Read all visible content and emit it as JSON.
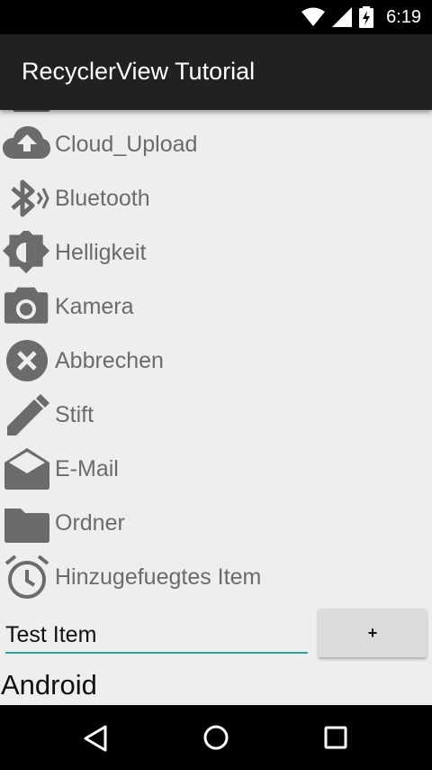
{
  "status_bar": {
    "time": "6:19",
    "icons": [
      "wifi-icon",
      "signal-icon",
      "battery-charging-icon"
    ]
  },
  "app_bar": {
    "title": "RecyclerView Tutorial"
  },
  "list": {
    "items": [
      {
        "label": "Cloud_Upload",
        "icon": "cloud-upload-icon"
      },
      {
        "label": "Bluetooth",
        "icon": "bluetooth-icon"
      },
      {
        "label": "Helligkeit",
        "icon": "brightness-icon"
      },
      {
        "label": "Kamera",
        "icon": "camera-icon"
      },
      {
        "label": "Abbrechen",
        "icon": "cancel-icon"
      },
      {
        "label": "Stift",
        "icon": "pencil-icon"
      },
      {
        "label": "E-Mail",
        "icon": "email-icon"
      },
      {
        "label": "Ordner",
        "icon": "folder-icon"
      },
      {
        "label": "Hinzugefuegtes Item",
        "icon": "alarm-icon"
      }
    ]
  },
  "input": {
    "value": "Test Item"
  },
  "add_button": {
    "label": "+"
  },
  "footer_label": "Android",
  "nav_bar": {
    "icons": [
      "back-icon",
      "home-icon",
      "recents-icon"
    ]
  },
  "colors": {
    "icon_gray": "#6b6b6b",
    "accent": "#26a69a",
    "app_bar": "#212121",
    "background": "#eeeeee"
  }
}
